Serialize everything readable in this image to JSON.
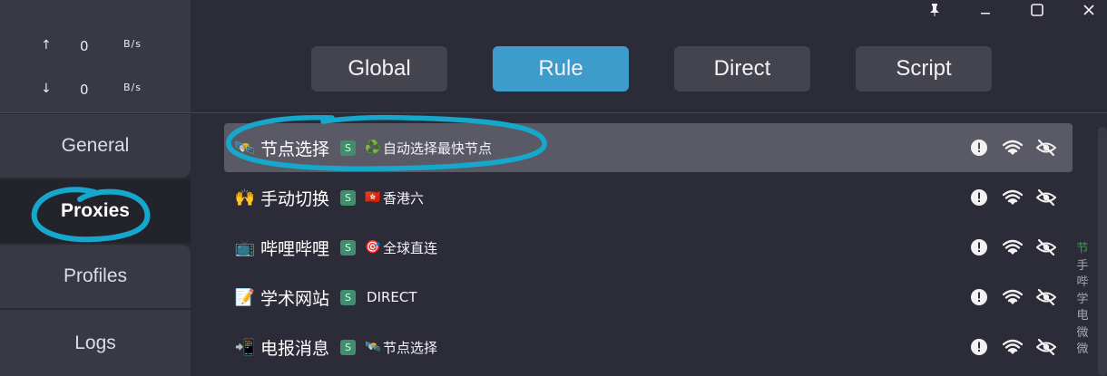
{
  "speed": {
    "up_arrow": "↑",
    "up_value": "0",
    "up_unit": "B/s",
    "down_arrow": "↓",
    "down_value": "0",
    "down_unit": "B/s"
  },
  "nav": {
    "general": "General",
    "proxies": "Proxies",
    "profiles": "Profiles",
    "logs": "Logs"
  },
  "modes": {
    "global": "Global",
    "rule": "Rule",
    "direct": "Direct",
    "script": "Script",
    "active": "Rule"
  },
  "proxy_groups": [
    {
      "icon": "🛰️",
      "name": "节点选择",
      "badge": "S",
      "now_icon": "♻️",
      "now": "自动选择最快节点"
    },
    {
      "icon": "🙌",
      "name": "手动切换",
      "badge": "S",
      "now_icon": "🇭🇰",
      "now": "香港六"
    },
    {
      "icon": "📺",
      "name": "哔哩哔哩",
      "badge": "S",
      "now_icon": "🎯",
      "now": "全球直连"
    },
    {
      "icon": "📝",
      "name": "学术网站",
      "badge": "S",
      "now_icon": "",
      "now": "DIRECT"
    },
    {
      "icon": "📲",
      "name": "电报消息",
      "badge": "S",
      "now_icon": "🛰️",
      "now": "节点选择"
    }
  ],
  "side_index": [
    "节",
    "手",
    "哔",
    "学",
    "电",
    "微",
    "微"
  ],
  "colors": {
    "accent": "#3d9ccc",
    "annotation": "#16a8cc",
    "badge": "#3f8f6c"
  }
}
